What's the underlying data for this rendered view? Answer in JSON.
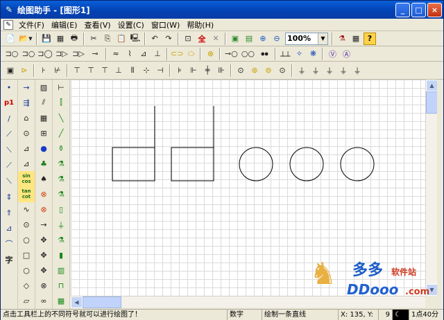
{
  "window": {
    "title": "绘图助手 - [图形1]",
    "app_icon": "pen-icon"
  },
  "controls": {
    "minimize": "_",
    "maximize": "□",
    "close": "×"
  },
  "menu": [
    "文件(F)",
    "编辑(E)",
    "查看(V)",
    "设置(C)",
    "窗口(W)",
    "帮助(H)"
  ],
  "toolbar1": {
    "items": [
      "📄",
      "📂▾",
      "💾",
      "▦",
      "🖶",
      "✂",
      "⎘",
      "📋",
      "🖳",
      "↶",
      "↷",
      "⊡",
      "全",
      "✕",
      "▣",
      "▤",
      "⊕",
      "⊖"
    ],
    "zoom_value": "100%",
    "after_zoom": [
      "⚗",
      "▦",
      "?"
    ]
  },
  "toolbar2": [
    "⊐○",
    "⊐○",
    "⊐◯",
    "⊐▷",
    "⊐▷",
    "⊸",
    "≈",
    "⌇",
    "⊿",
    "⊥",
    "⊂⊃",
    "⬭",
    "⊗",
    "⊸○",
    "○○",
    "⦁⦁",
    "⟂⟂",
    "✧",
    "❋",
    "Ⓥ",
    "Ⓐ"
  ],
  "toolbar3": [
    "▣",
    "⊳",
    "⊦",
    "⊬",
    "⊤",
    "⊤",
    "⊤",
    "⊥",
    "⫴",
    "⊹",
    "⊣",
    "⊧",
    "⊩",
    "╪",
    "⊪",
    "⊙",
    "⊛",
    "⊚",
    "⊙",
    "⏚",
    "⏚",
    "⏚",
    "⏚",
    "⏚"
  ],
  "palette": [
    [
      "•",
      "p1",
      "/",
      "⟋",
      "⟍",
      "⟋",
      "⟍",
      "⇕",
      "⇑",
      "⊿",
      "⌒",
      "字"
    ],
    [
      "→",
      "⇶",
      "⌂",
      "⊙",
      "⊿",
      "⊿",
      "sin cos",
      "tan cot",
      "∿",
      "⊙",
      "○",
      "□",
      "○",
      "◇",
      "▱"
    ],
    [
      "▨",
      "⫽",
      "▦",
      "⊞",
      "●",
      "♣",
      "♠",
      "⊗",
      "⊗",
      "→",
      "✥",
      "✥",
      "✥",
      "⊗",
      "∞"
    ],
    [
      "⊢",
      "⫿",
      "╲",
      "╱",
      "⚱",
      "⚗",
      "⚗",
      "⚗",
      "▯",
      "⏚",
      "⚗",
      "▮",
      "▥",
      "⊓",
      "▦"
    ]
  ],
  "status": {
    "hint": "点击工具栏上的不同符号就可以进行绘图了！",
    "mode": "数字",
    "action": "绘制一条直线",
    "coords": "X: 135, Y:",
    "num": "9",
    "time": "1点40分"
  },
  "watermark": {
    "cn": "多多",
    "sub": "软件站",
    "en": "DDooo",
    "com": ".com"
  }
}
